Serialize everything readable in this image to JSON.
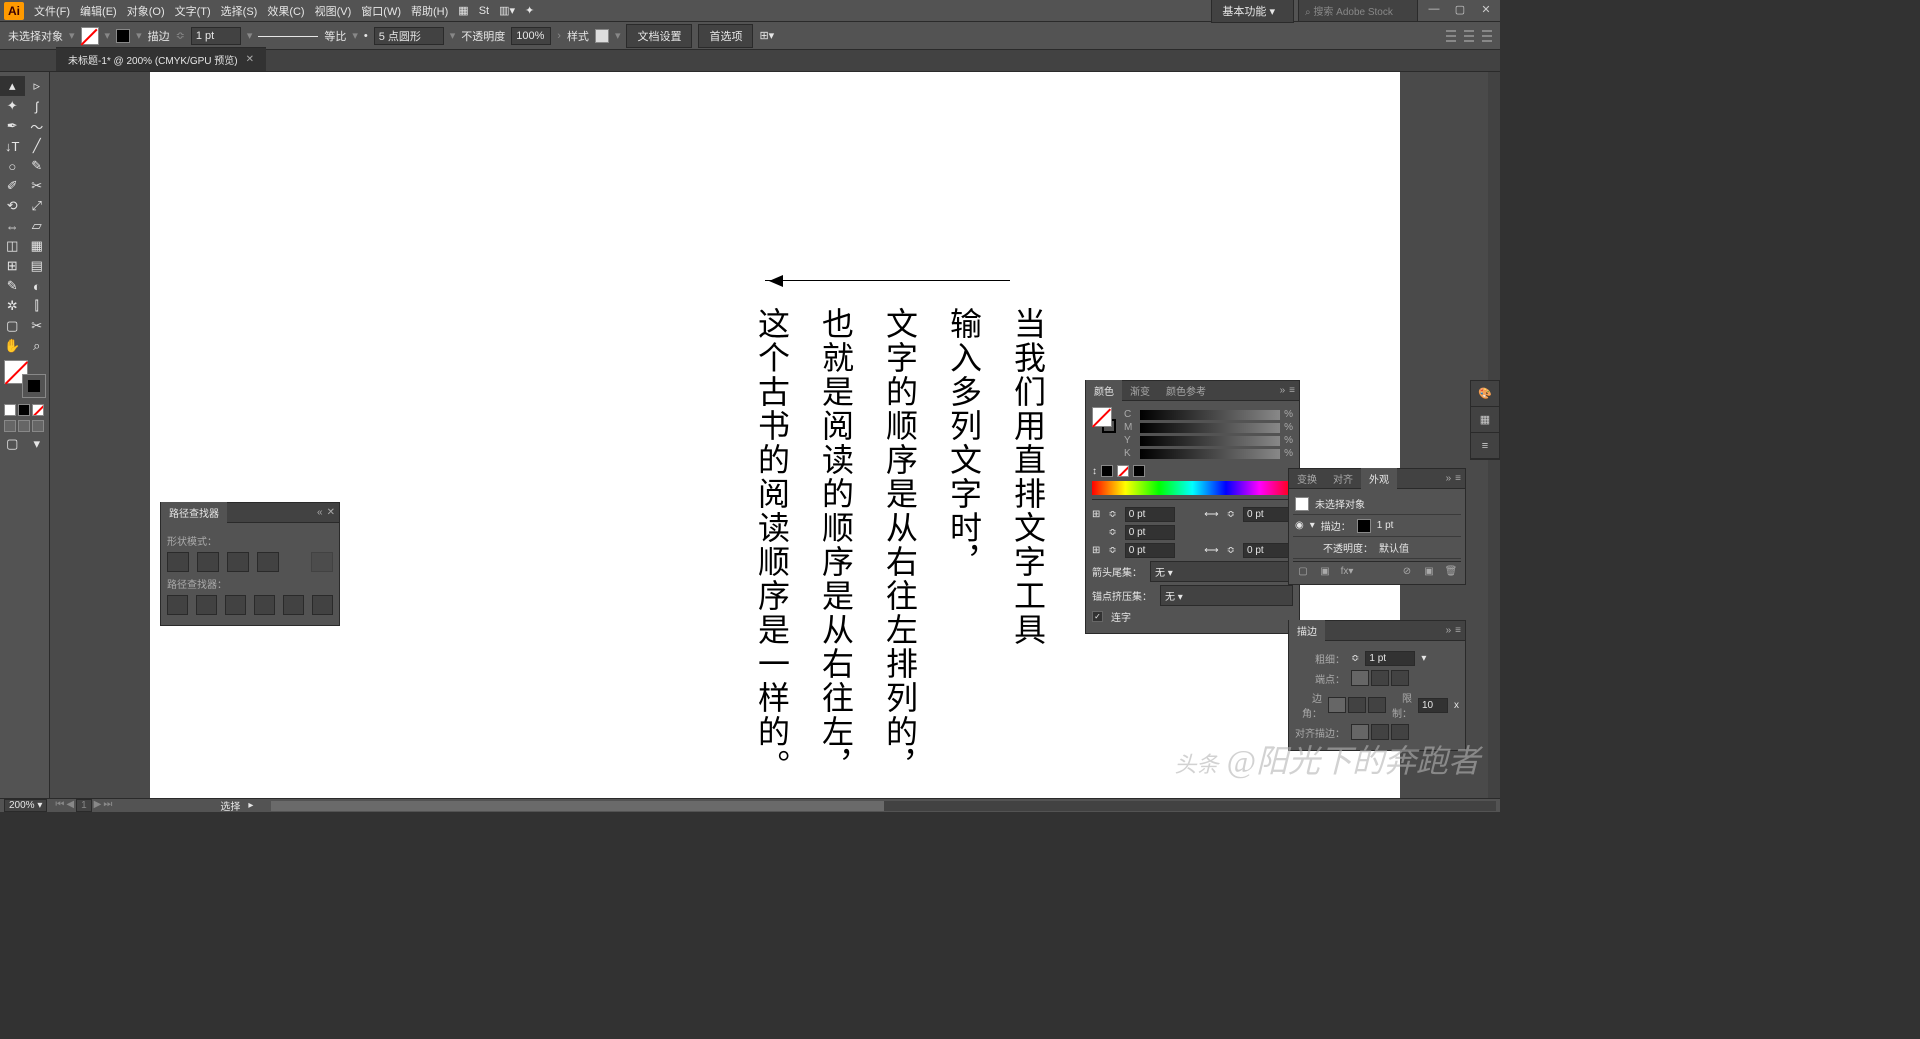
{
  "menubar": {
    "items": [
      "文件(F)",
      "编辑(E)",
      "对象(O)",
      "文字(T)",
      "选择(S)",
      "效果(C)",
      "视图(V)",
      "窗口(W)",
      "帮助(H)"
    ],
    "workspace": "基本功能",
    "search_placeholder": "搜索 Adobe Stock"
  },
  "controlbar": {
    "selection": "未选择对象",
    "stroke_label": "描边",
    "stroke_weight": "1 pt",
    "dash_label": "等比",
    "brush_val": "5 点圆形",
    "opacity_label": "不透明度",
    "opacity_val": "100%",
    "style_label": "样式",
    "btn1": "文档设置",
    "btn2": "首选项"
  },
  "tab": {
    "title": "未标题-1* @ 200% (CMYK/GPU 预览)"
  },
  "canvas": {
    "columns": [
      "当我们用直排文字工具",
      "输入多列文字时，",
      "文字的顺序是从右往左排列的，",
      "也就是阅读的顺序是从右往左，",
      "这个古书的阅读顺序是一样的。"
    ]
  },
  "pathfinder": {
    "title": "路径查找器",
    "label1": "形状模式：",
    "label2": "路径查找器："
  },
  "colorpanel": {
    "tabs": [
      "颜色",
      "渐变",
      "颜色参考"
    ],
    "channels": [
      "C",
      "M",
      "Y",
      "K"
    ],
    "transform_pts": [
      "0 pt",
      "0 pt",
      "0 pt",
      "0 pt"
    ],
    "arrow_label1": "箭头尾集：",
    "arrow_label2": "锚点挤压集：",
    "arrow_val": "无",
    "chk_label": "连字"
  },
  "appearance": {
    "tabs": [
      "变换",
      "对齐",
      "外观"
    ],
    "noselect": "未选择对象",
    "stroke_label": "描边：",
    "stroke_val": "1 pt",
    "opacity_label": "不透明度：",
    "opacity_val": "默认值"
  },
  "stroke": {
    "title": "描边",
    "weight_label": "粗细：",
    "weight_val": "1 pt",
    "cap_label": "端点：",
    "corner_label": "边角：",
    "limit_label": "限制：",
    "limit_val": "10",
    "align_label": "对齐描边："
  },
  "statusbar": {
    "zoom": "200%",
    "page": "1",
    "tool": "选择"
  },
  "watermark": {
    "pre": "头条",
    "text": " @阳光下的奔跑者"
  }
}
